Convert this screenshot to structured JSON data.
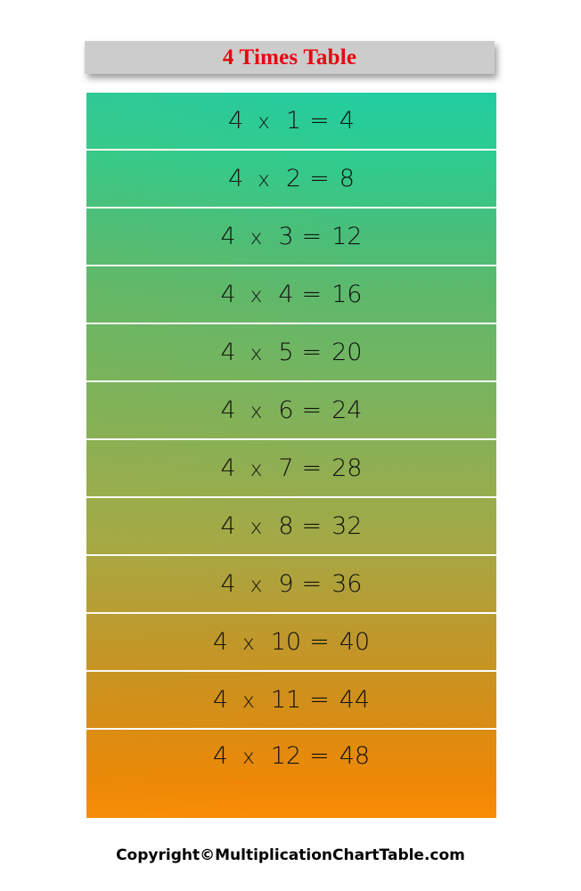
{
  "header": {
    "title": "4 Times Table",
    "background_color": "#cccccc",
    "title_color": "#ea0410"
  },
  "table": {
    "multiplicand": "4",
    "operator": "x",
    "equals": "=",
    "gradient_start_color": "#22cca1",
    "gradient_mid_color": "#92ae51",
    "gradient_end_color": "#fa8c05",
    "separator_color": "#ffffff",
    "rows": [
      {
        "a": "4",
        "op": "x",
        "b": "1",
        "eq": "=",
        "result": "4"
      },
      {
        "a": "4",
        "op": "x",
        "b": "2",
        "eq": "=",
        "result": "8"
      },
      {
        "a": "4",
        "op": "x",
        "b": "3",
        "eq": "=",
        "result": "12"
      },
      {
        "a": "4",
        "op": "x",
        "b": "4",
        "eq": "=",
        "result": "16"
      },
      {
        "a": "4",
        "op": "x",
        "b": "5",
        "eq": "=",
        "result": "20"
      },
      {
        "a": "4",
        "op": "x",
        "b": "6",
        "eq": "=",
        "result": "24"
      },
      {
        "a": "4",
        "op": "x",
        "b": "7",
        "eq": "=",
        "result": "28"
      },
      {
        "a": "4",
        "op": "x",
        "b": "8",
        "eq": "=",
        "result": "32"
      },
      {
        "a": "4",
        "op": "x",
        "b": "9",
        "eq": "=",
        "result": "36"
      },
      {
        "a": "4",
        "op": "x",
        "b": "10",
        "eq": "=",
        "result": "40"
      },
      {
        "a": "4",
        "op": "x",
        "b": "11",
        "eq": "=",
        "result": "44"
      },
      {
        "a": "4",
        "op": "x",
        "b": "12",
        "eq": "=",
        "result": "48"
      }
    ]
  },
  "footer": {
    "copyright": "Copyright©MultiplicationChartTable.com"
  }
}
